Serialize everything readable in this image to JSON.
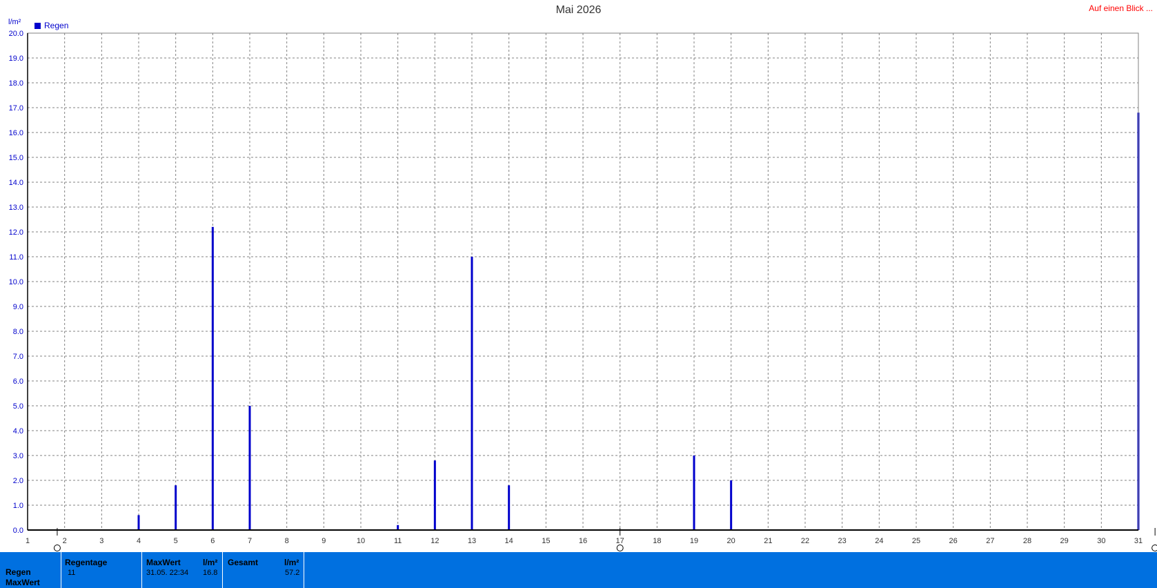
{
  "chart_data": {
    "type": "bar",
    "title": "Mai 2026",
    "ylabel": "l/m²",
    "xlabel": "",
    "ylim": [
      0,
      20
    ],
    "xlim": [
      1,
      31
    ],
    "y_ticks": [
      "0.0",
      "1.0",
      "2.0",
      "3.0",
      "4.0",
      "5.0",
      "6.0",
      "7.0",
      "8.0",
      "9.0",
      "10.0",
      "11.0",
      "12.0",
      "13.0",
      "14.0",
      "15.0",
      "16.0",
      "17.0",
      "18.0",
      "19.0",
      "20.0"
    ],
    "x_ticks": [
      "1",
      "2",
      "3",
      "4",
      "5",
      "6",
      "7",
      "8",
      "9",
      "10",
      "11",
      "12",
      "13",
      "14",
      "15",
      "16",
      "17",
      "18",
      "19",
      "20",
      "21",
      "22",
      "23",
      "24",
      "25",
      "26",
      "27",
      "28",
      "29",
      "30",
      "31"
    ],
    "grid": true,
    "legend_position": "top-left",
    "series": [
      {
        "name": "Regen",
        "color": "#0000cc",
        "x": [
          4,
          5,
          6,
          7,
          11,
          12,
          13,
          14,
          19,
          20,
          31
        ],
        "values": [
          0.6,
          1.8,
          12.2,
          5.0,
          0.2,
          2.8,
          11.0,
          1.8,
          3.0,
          2.0,
          16.8
        ]
      }
    ]
  },
  "header": {
    "glance_link": "Auf einen Blick ..."
  },
  "legend": {
    "label": "Regen"
  },
  "stats": {
    "row_label_1": "Regen",
    "row_label_2": "MaxWert",
    "regentage_header": "Regentage",
    "regentage_value": "11",
    "maxwert_header": "MaxWert",
    "maxwert_unit": "l/m²",
    "maxwert_date": "31.05.  22:34",
    "maxwert_value": "16.8",
    "gesamt_header": "Gesamt",
    "gesamt_unit": "l/m²",
    "gesamt_value": "57.2"
  },
  "colors": {
    "bar": "#0000cc",
    "axis_label": "#0000cc",
    "grid": "#808080",
    "stats_band": "#0070e0",
    "link": "#ff0000"
  }
}
